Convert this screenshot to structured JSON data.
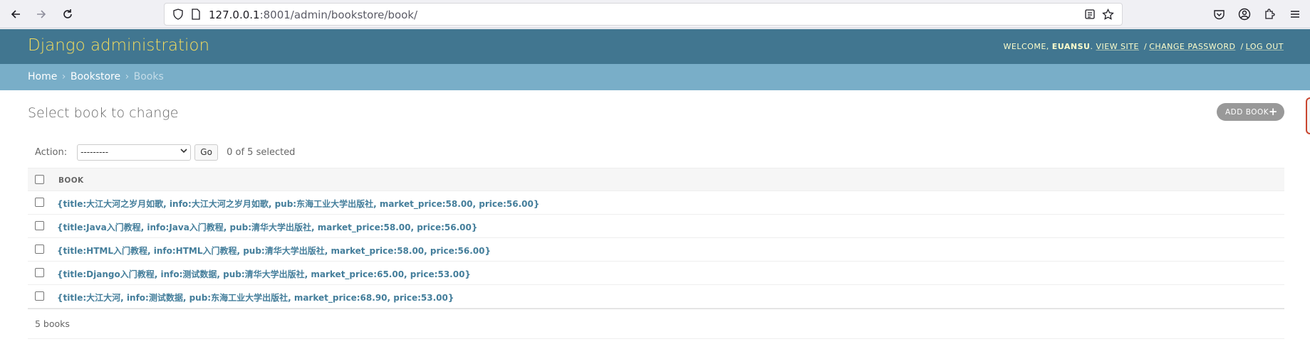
{
  "browser": {
    "url_host": "127.0.0.1",
    "url_rest": ":8001/admin/bookstore/book/"
  },
  "header": {
    "branding": "Django administration",
    "welcome": "WELCOME,",
    "username": "EUANSU",
    "view_site": "VIEW SITE",
    "change_password": "CHANGE PASSWORD",
    "log_out": "LOG OUT",
    "separator": "/"
  },
  "breadcrumbs": {
    "home": "Home",
    "app": "Bookstore",
    "current": "Books",
    "separator": "›"
  },
  "content": {
    "title": "Select book to change",
    "add_button": "ADD BOOK",
    "action_label": "Action:",
    "action_select_value": "---------",
    "go_label": "Go",
    "selected_count": "0 of 5 selected",
    "column_header": "BOOK",
    "rows": [
      "{title:大江大河之岁月如歌, info:大江大河之岁月如歌, pub:东海工业大学出版社, market_price:58.00, price:56.00}",
      "{title:Java入门教程, info:Java入门教程, pub:清华大学出版社, market_price:58.00, price:56.00}",
      "{title:HTML入门教程, info:HTML入门教程, pub:清华大学出版社, market_price:58.00, price:56.00}",
      "{title:Django入门教程, info:测试数据, pub:清华大学出版社, market_price:65.00, price:53.00}",
      "{title:大江大河, info:测试数据, pub:东海工业大学出版社, market_price:68.90, price:53.00}"
    ],
    "result_count": "5 books"
  },
  "colors": {
    "header_bg": "#417690",
    "breadcrumb_bg": "#79aec8",
    "branding": "#f5dd5d",
    "link": "#447e9b"
  }
}
